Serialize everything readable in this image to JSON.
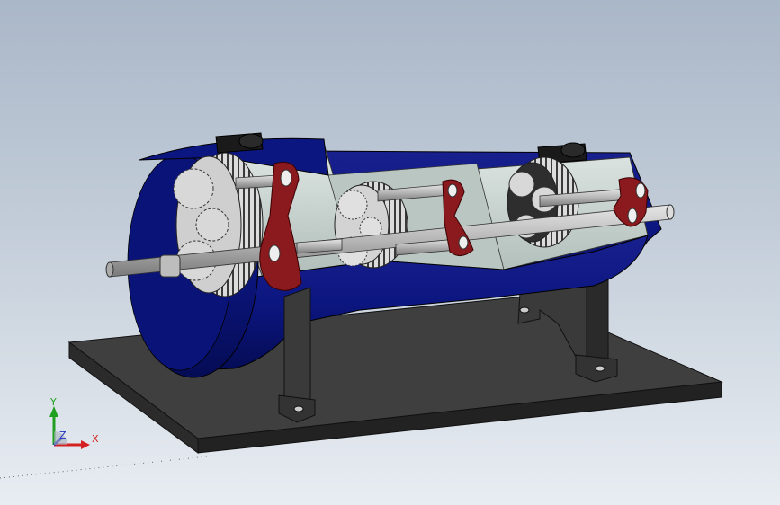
{
  "viewport": {
    "background_top": "#aab7c8",
    "background_bottom": "#e8edf2"
  },
  "model": {
    "housing_color": "#0a1478",
    "carrier_color": "#8b1a1e",
    "base_plate_color": "#3a3a3a",
    "shaft_color": "#c0c0c0",
    "gear_color": "#d9d9d9",
    "housing_inner_color": "#c8d4d0"
  },
  "triad": {
    "x_label": "X",
    "y_label": "Y",
    "z_label": "Z",
    "x_color": "#d42020",
    "y_color": "#20a020",
    "z_color": "#2030c0"
  }
}
